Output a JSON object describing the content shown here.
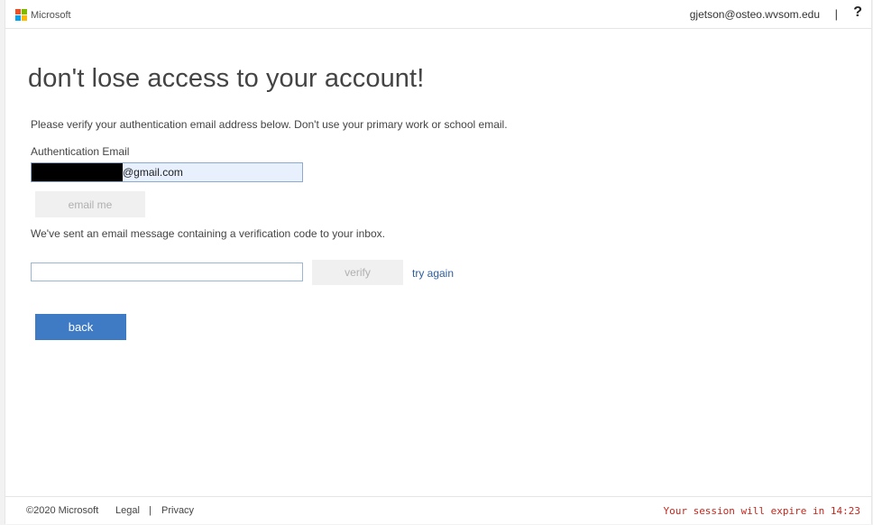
{
  "header": {
    "brand": "Microsoft",
    "user_email": "gjetson@osteo.wvsom.edu",
    "separator": "|",
    "help_label": "?"
  },
  "main": {
    "title": "don't lose access to your account!",
    "intro": "Please verify your authentication email address below. Don't use your primary work or school email.",
    "auth_email_label": "Authentication Email",
    "auth_email_value": "@gmail.com",
    "email_me_label": "email me",
    "sent_message": "We've sent an email message containing a verification code to your inbox.",
    "code_value": "",
    "verify_label": "verify",
    "try_again_label": "try again",
    "back_label": "back"
  },
  "footer": {
    "copyright": "©2020 Microsoft",
    "legal": "Legal",
    "separator": "|",
    "privacy": "Privacy",
    "session_text": "Your session will expire in 14:23"
  },
  "colors": {
    "logo_red": "#f25022",
    "logo_green": "#7fba00",
    "logo_blue": "#00a4ef",
    "logo_yellow": "#ffb900",
    "primary_button": "#3f7bc4",
    "link": "#2e5d9c",
    "session_warning": "#c0281e"
  }
}
